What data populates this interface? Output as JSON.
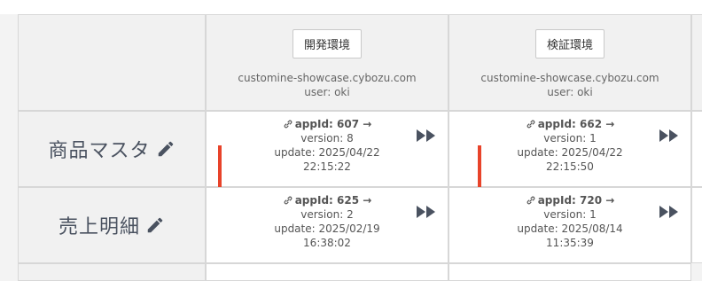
{
  "envs": [
    {
      "button": "開発環境",
      "domain": "customine-showcase.cybozu.com",
      "user": "user: oki"
    },
    {
      "button": "検証環境",
      "domain": "customine-showcase.cybozu.com",
      "user": "user: oki"
    }
  ],
  "rows": [
    {
      "name": "商品マスタ",
      "apps": [
        {
          "appid": "appId: 607 →",
          "version": "version: 8",
          "update": "update: 2025/04/22",
          "time": "22:15:22"
        },
        {
          "appid": "appId: 662 →",
          "version": "version: 1",
          "update": "update: 2025/04/22",
          "time": "22:15:50"
        }
      ]
    },
    {
      "name": "売上明細",
      "apps": [
        {
          "appid": "appId: 625 →",
          "version": "version: 2",
          "update": "update: 2025/02/19",
          "time": "16:38:02"
        },
        {
          "appid": "appId: 720 →",
          "version": "version: 1",
          "update": "update: 2025/08/14",
          "time": "11:35:39"
        }
      ]
    }
  ],
  "colors": {
    "arrow": "#e8432a",
    "icon": "#4a5260"
  },
  "icons": {
    "edit": "pencil-icon",
    "link": "link-icon",
    "deploy": "fast-forward-icon",
    "marker": "arrow-down-icon"
  }
}
